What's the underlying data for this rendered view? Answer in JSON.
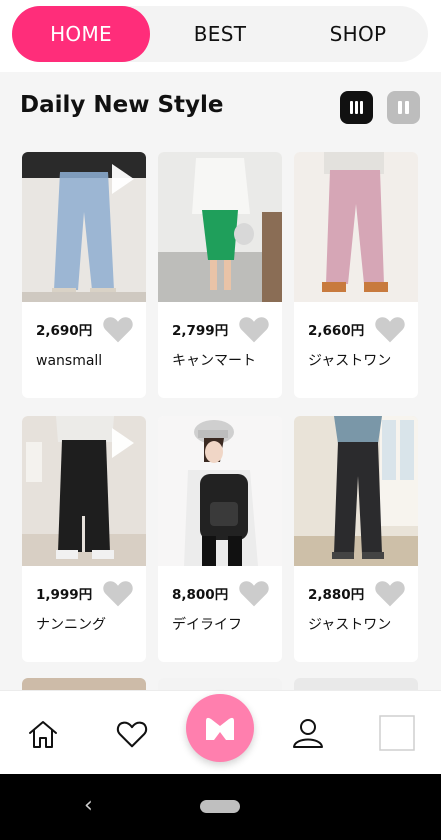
{
  "tabs": [
    {
      "label": "HOME",
      "active": true
    },
    {
      "label": "BEST",
      "active": false
    },
    {
      "label": "SHOP",
      "active": false
    }
  ],
  "section": {
    "title": "Daily New Style"
  },
  "view_toggle": {
    "options": [
      "grid-3-icon",
      "grid-2-icon"
    ],
    "selected": "grid-3-icon"
  },
  "products": [
    {
      "price": "2,690円",
      "name": "wansmall",
      "photo": "light-wash-wide-jeans",
      "video": true
    },
    {
      "price": "2,799円",
      "name": "キャンマート",
      "photo": "green-skirt-white-tee",
      "video": false
    },
    {
      "price": "2,660円",
      "name": "ジャストワン",
      "photo": "pink-flare-pants",
      "video": false
    },
    {
      "price": "1,999円",
      "name": "ナンニング",
      "photo": "black-slit-skirt",
      "video": true
    },
    {
      "price": "8,800円",
      "name": "デイライフ",
      "photo": "black-backpack-white-hoodie",
      "video": false
    },
    {
      "price": "2,880円",
      "name": "ジャストワン",
      "photo": "black-wide-slacks",
      "video": false
    }
  ],
  "bottom_nav": [
    "home-icon",
    "heart-icon",
    "brand-logo",
    "profile-icon",
    "square-icon"
  ],
  "colors": {
    "accent": "#ff2d7a",
    "fab": "#ff7fae",
    "heart": "#cccccc"
  }
}
